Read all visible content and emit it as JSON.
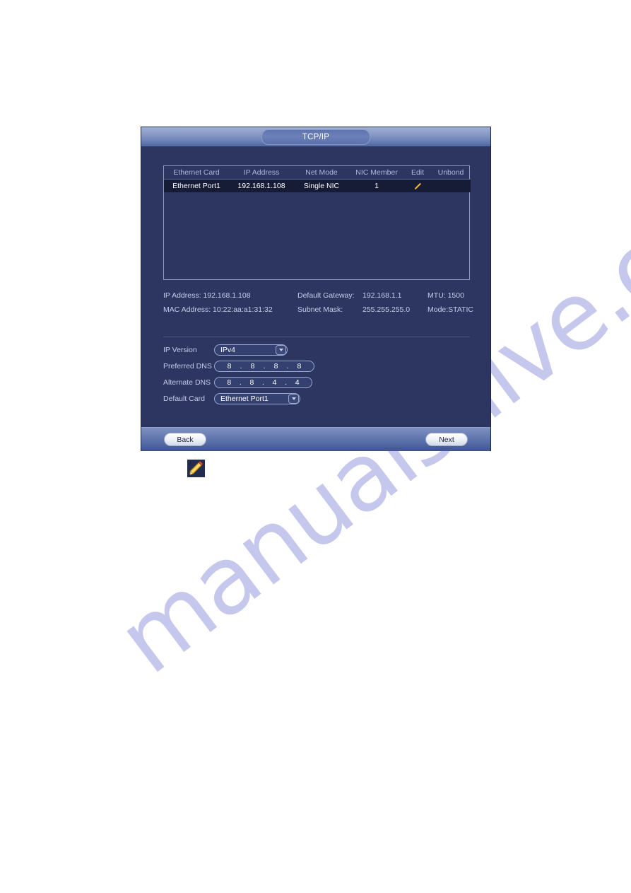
{
  "watermark": {
    "text": "manualshive.com"
  },
  "dialog": {
    "title": "TCP/IP",
    "table": {
      "headers": [
        "Ethernet Card",
        "IP Address",
        "Net Mode",
        "NIC Member",
        "Edit",
        "Unbond"
      ],
      "rows": [
        {
          "ethernet_card": "Ethernet Port1",
          "ip_address": "192.168.1.108",
          "net_mode": "Single NIC",
          "nic_member": "1",
          "edit_icon": "pencil-icon",
          "unbond": ""
        }
      ]
    },
    "info": {
      "ip_address_label": "IP Address: 192.168.1.108",
      "mac_address_label": "MAC Address: 10:22:aa:a1:31:32",
      "default_gateway_label": "Default Gateway:",
      "default_gateway_value": "192.168.1.1",
      "subnet_mask_label": "Subnet Mask:",
      "subnet_mask_value": "255.255.255.0",
      "mtu_label": "MTU: 1500",
      "mode_label": "Mode:STATIC"
    },
    "form": {
      "ip_version_label": "IP Version",
      "ip_version_value": "IPv4",
      "preferred_dns_label": "Preferred DNS",
      "preferred_dns": [
        "8",
        "8",
        "8",
        "8"
      ],
      "alternate_dns_label": "Alternate DNS",
      "alternate_dns": [
        "8",
        "8",
        "4",
        "4"
      ],
      "default_card_label": "Default Card",
      "default_card_value": "Ethernet Port1",
      "dot": "."
    },
    "footer": {
      "back_label": "Back",
      "next_label": "Next"
    }
  },
  "legend": {
    "pencil_icon": "pencil-icon"
  },
  "colors": {
    "dialog_body": "#2d3660",
    "titlebar_top": "#9fb0d4",
    "selected_row": "#161c35",
    "label_text": "#c5cdea",
    "header_text": "#a9b6dd",
    "pencil_yellow": "#f0c040"
  }
}
